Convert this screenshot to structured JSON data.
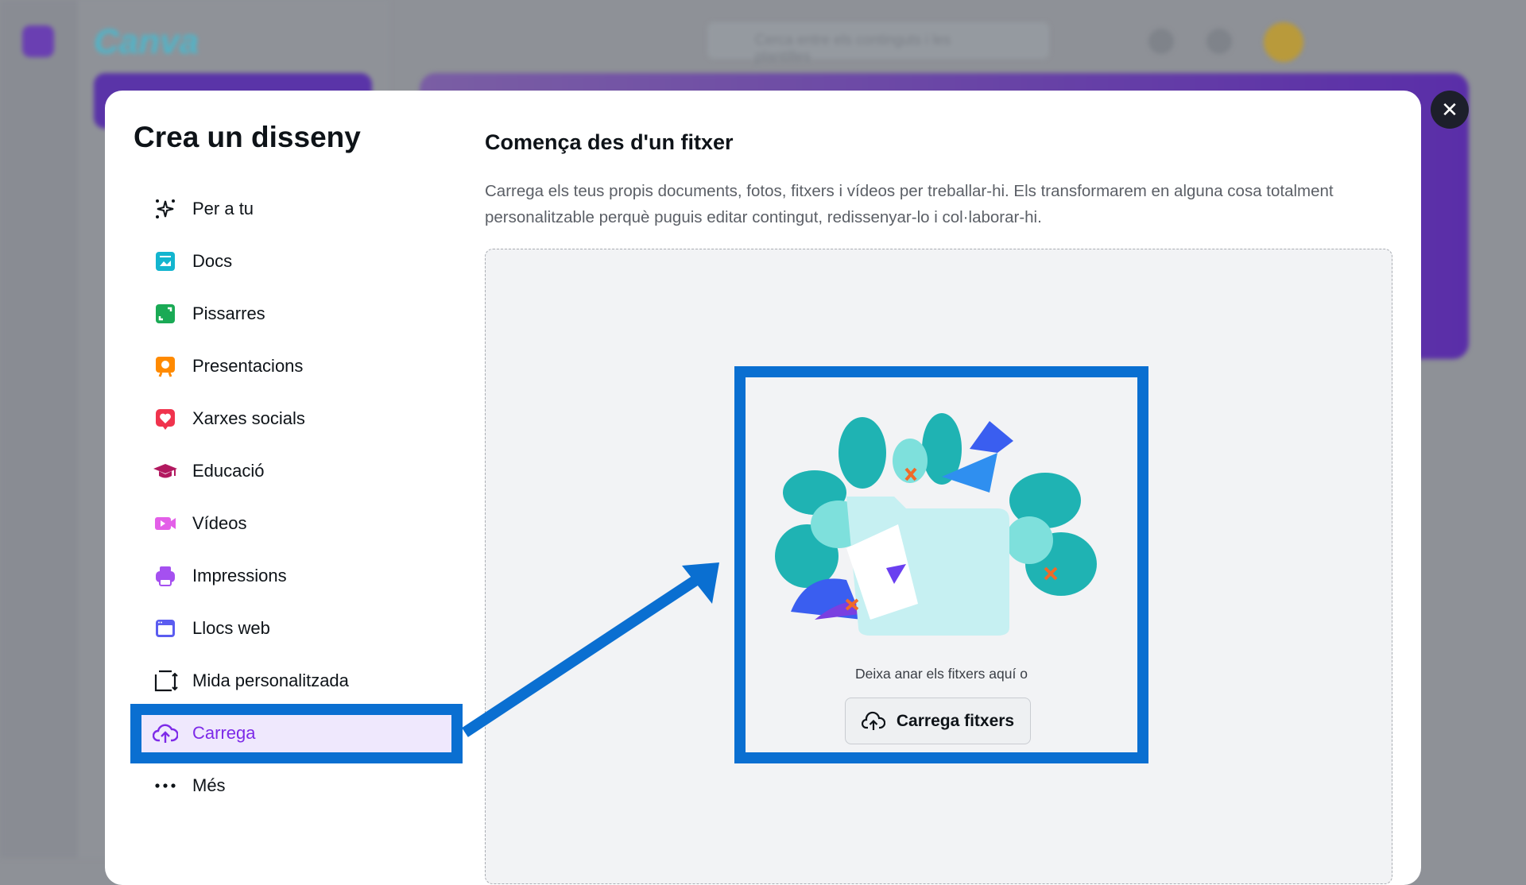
{
  "background": {
    "logo": "Canva",
    "search_placeholder": "Cerca entre els continguts i les plantilles"
  },
  "modal": {
    "title": "Crea un disseny",
    "close_icon": "close-icon",
    "menu": [
      {
        "label": "Per a tu",
        "icon": "sparkle-icon",
        "color": "#0e1318"
      },
      {
        "label": "Docs",
        "icon": "docs-icon",
        "color": "#13b5cf"
      },
      {
        "label": "Pissarres",
        "icon": "whiteboard-icon",
        "color": "#1aaa55"
      },
      {
        "label": "Presentacions",
        "icon": "presentation-icon",
        "color": "#ff8a00"
      },
      {
        "label": "Xarxes socials",
        "icon": "heart-icon",
        "color": "#f0334d"
      },
      {
        "label": "Educació",
        "icon": "graduation-cap-icon",
        "color": "#b2185f"
      },
      {
        "label": "Vídeos",
        "icon": "video-icon",
        "color": "#e35fe8"
      },
      {
        "label": "Impressions",
        "icon": "printer-icon",
        "color": "#a550f0"
      },
      {
        "label": "Llocs web",
        "icon": "website-icon",
        "color": "#5b5cf0"
      },
      {
        "label": "Mida personalitzada",
        "icon": "custom-size-icon",
        "color": "#0e1318"
      },
      {
        "label": "Carrega",
        "icon": "cloud-upload-icon",
        "color": "#7d2ae8",
        "active": true
      },
      {
        "label": "Més",
        "icon": "more-icon",
        "color": "#0e1318"
      }
    ],
    "content": {
      "heading": "Comença des d'un fitxer",
      "description": "Carrega els teus propis documents, fotos, fitxers i vídeos per treballar-hi. Els transformarem en alguna cosa totalment personalitzable perquè puguis editar contingut, redissenyar-lo i col·laborar-hi.",
      "drop_hint": "Deixa anar els fitxers aquí o",
      "upload_button": "Carrega fitxers"
    }
  },
  "annotation_color": "#0a6fd1"
}
